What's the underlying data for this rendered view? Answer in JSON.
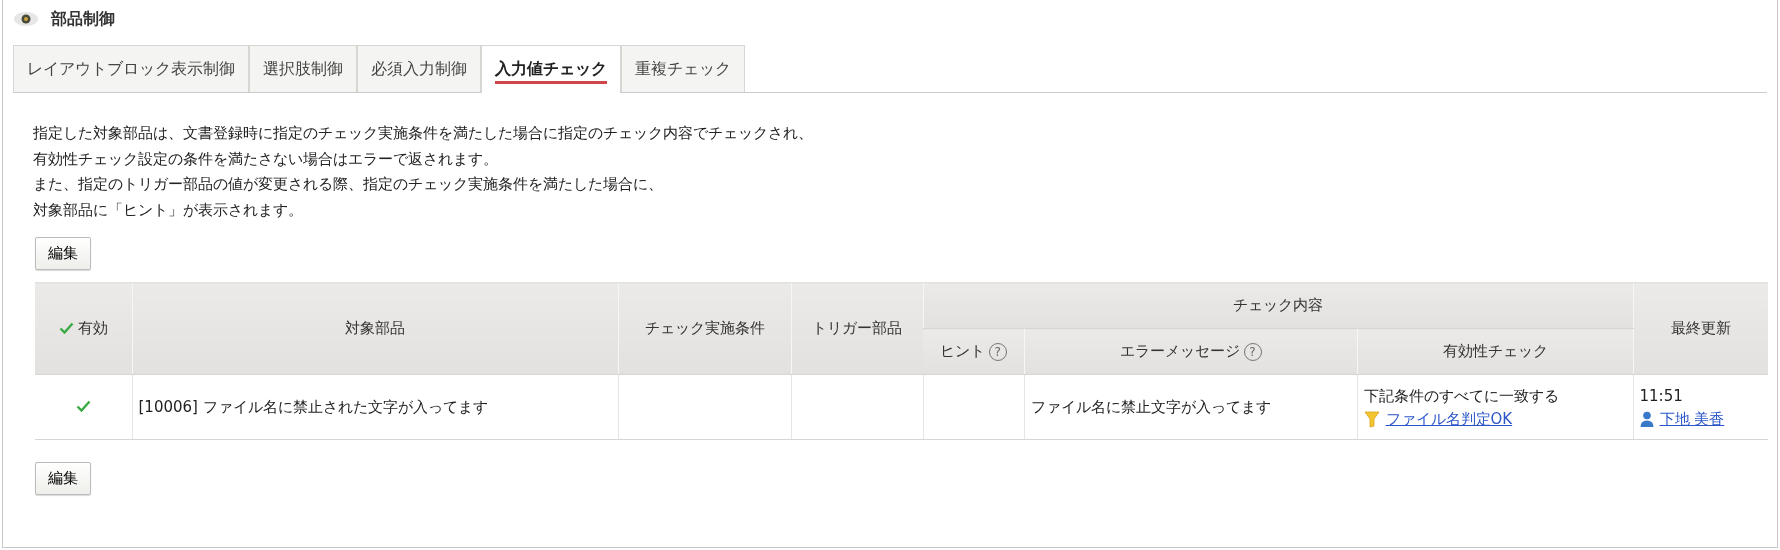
{
  "header": {
    "title": "部品制御"
  },
  "tabs": [
    {
      "label": "レイアウトブロック表示制御",
      "selected": false
    },
    {
      "label": "選択肢制御",
      "selected": false
    },
    {
      "label": "必須入力制御",
      "selected": false
    },
    {
      "label": "入力値チェック",
      "selected": true
    },
    {
      "label": "重複チェック",
      "selected": false
    }
  ],
  "description": [
    "指定した対象部品は、文書登録時に指定のチェック実施条件を満たした場合に指定のチェック内容でチェックされ、",
    "有効性チェック設定の条件を満たさない場合はエラーで返されます。",
    "また、指定のトリガー部品の値が変更される際、指定のチェック実施条件を満たした場合に、",
    "対象部品に「ヒント」が表示されます。"
  ],
  "top_button": "編集",
  "table": {
    "columns": {
      "enabled": "有効",
      "target": "対象部品",
      "condition": "チェック実施条件",
      "trigger": "トリガー部品",
      "group": "チェック内容",
      "hint": "ヒント",
      "hint_help": "?",
      "error_message": "エラーメッセージ",
      "error_message_help": "?",
      "validity": "有効性チェック",
      "updated": "最終更新"
    },
    "rows": [
      {
        "enabled": true,
        "target": "[10006] ファイル名に禁止された文字が入ってます",
        "error_message": "ファイル名に禁止文字が入ってます",
        "validity": {
          "rule": "下記条件のすべてに一致する",
          "link": "ファイル名判定OK"
        },
        "updated": {
          "time": "11:51",
          "user": "下地 美香"
        }
      }
    ]
  },
  "bottom_button": "編集"
}
